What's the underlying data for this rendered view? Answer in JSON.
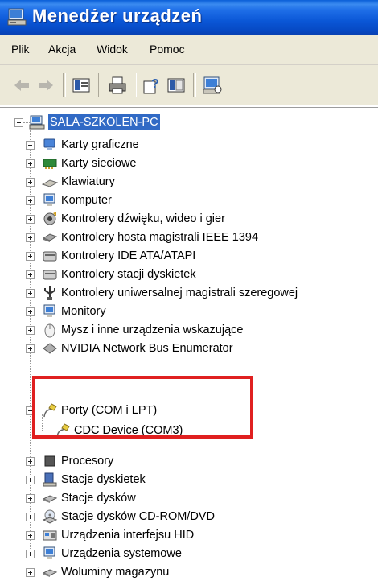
{
  "window": {
    "title": "Menedżer urządzeń"
  },
  "menu": {
    "items": [
      "Plik",
      "Akcja",
      "Widok",
      "Pomoc"
    ]
  },
  "tree": {
    "root": {
      "label": "SALA-SZKOLEN-PC",
      "icon": "computer-icon"
    },
    "categories": [
      {
        "label": "Karty graficzne",
        "icon": "display-adapter-icon",
        "expanded": false
      },
      {
        "label": "Karty sieciowe",
        "icon": "network-card-icon",
        "expanded": false
      },
      {
        "label": "Klawiatury",
        "icon": "keyboard-icon",
        "expanded": false
      },
      {
        "label": "Komputer",
        "icon": "computer-icon",
        "expanded": false
      },
      {
        "label": "Kontrolery dźwięku, wideo i gier",
        "icon": "sound-icon",
        "expanded": false
      },
      {
        "label": "Kontrolery hosta magistrali IEEE 1394",
        "icon": "ieee1394-icon",
        "expanded": false
      },
      {
        "label": "Kontrolery IDE ATA/ATAPI",
        "icon": "ide-controller-icon",
        "expanded": false
      },
      {
        "label": "Kontrolery stacji dyskietek",
        "icon": "floppy-controller-icon",
        "expanded": false
      },
      {
        "label": "Kontrolery uniwersalnej magistrali szeregowej",
        "icon": "usb-icon",
        "expanded": false
      },
      {
        "label": "Monitory",
        "icon": "monitor-icon",
        "expanded": false
      },
      {
        "label": "Mysz i inne urządzenia wskazujące",
        "icon": "mouse-icon",
        "expanded": false
      },
      {
        "label": "NVIDIA Network Bus Enumerator",
        "icon": "device-icon",
        "expanded": false
      },
      {
        "label": "Porty (COM i LPT)",
        "icon": "port-icon",
        "expanded": true,
        "children": [
          {
            "label": "CDC Device (COM3)",
            "icon": "port-icon"
          }
        ]
      },
      {
        "label": "Procesory",
        "icon": "processor-icon",
        "expanded": false
      },
      {
        "label": "Stacje dyskietek",
        "icon": "floppy-drive-icon",
        "expanded": false
      },
      {
        "label": "Stacje dysków",
        "icon": "disk-drive-icon",
        "expanded": false
      },
      {
        "label": "Stacje dysków CD-ROM/DVD",
        "icon": "cdrom-icon",
        "expanded": false
      },
      {
        "label": "Urządzenia interfejsu HID",
        "icon": "hid-icon",
        "expanded": false
      },
      {
        "label": "Urządzenia systemowe",
        "icon": "system-device-icon",
        "expanded": false
      },
      {
        "label": "Woluminy magazynu",
        "icon": "storage-volume-icon",
        "expanded": false
      }
    ]
  },
  "colors": {
    "title_bar": "#0a56d6",
    "selection": "#316ac5",
    "highlight_border": "#e02020",
    "menu_bg": "#ece9d8"
  }
}
